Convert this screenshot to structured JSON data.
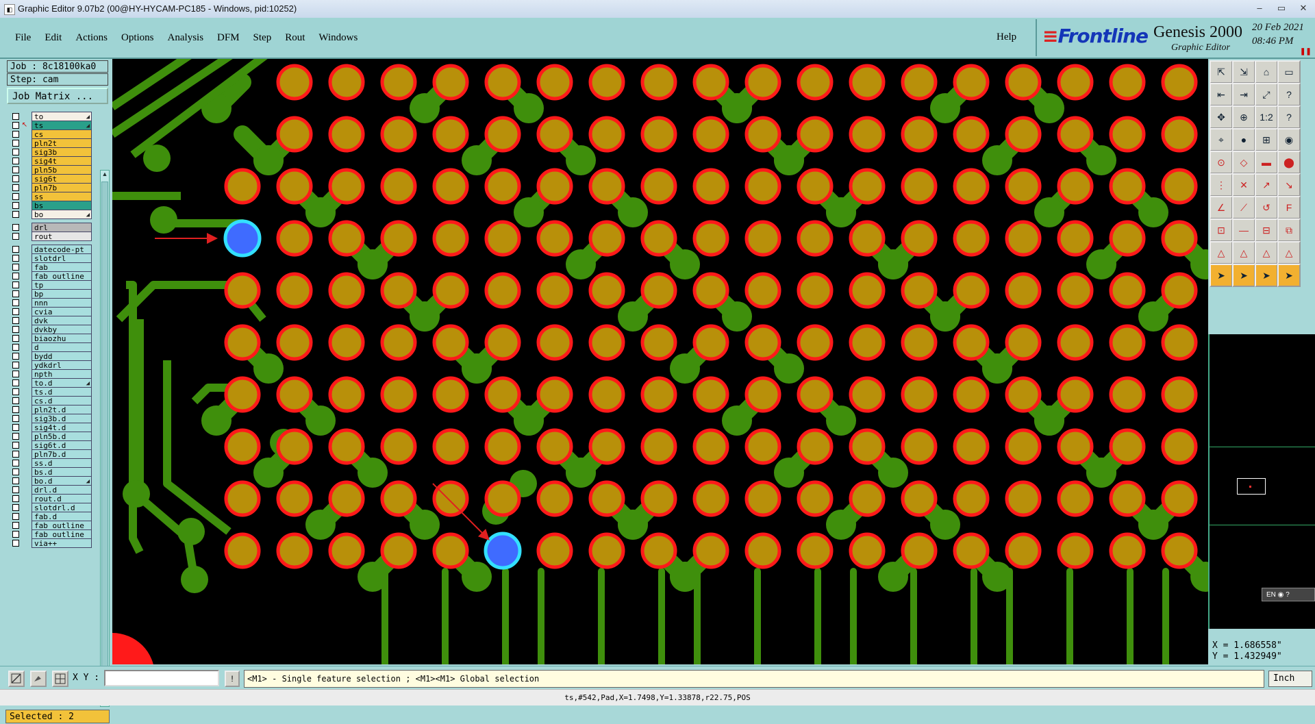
{
  "window": {
    "title": "Graphic Editor 9.07b2 (00@HY-HYCAM-PC185 - Windows, pid:10252)",
    "min": "–",
    "max": "▭",
    "close": "✕"
  },
  "menu": [
    "File",
    "Edit",
    "Actions",
    "Options",
    "Analysis",
    "DFM",
    "Step",
    "Rout",
    "Windows"
  ],
  "help_label": "Help",
  "brand": {
    "logo": "Frontline",
    "product": "Genesis 2000",
    "subtitle": "Graphic Editor",
    "date": "20 Feb 2021",
    "time": "08:46 PM"
  },
  "job": "Job : 8c18100ka0",
  "step": "Step: cam",
  "job_matrix": "Job Matrix ...",
  "layers": [
    {
      "name": "to",
      "color": "#f5f0e6",
      "marker": "",
      "editable": true
    },
    {
      "name": "ts",
      "color": "#2aa08a",
      "marker": "↖",
      "editable": true
    },
    {
      "name": "cs",
      "color": "#f2c23a",
      "marker": "",
      "editable": false
    },
    {
      "name": "pln2t",
      "color": "#f2c23a",
      "marker": "",
      "editable": false
    },
    {
      "name": "sig3b",
      "color": "#f2c23a",
      "marker": "",
      "editable": false
    },
    {
      "name": "sig4t",
      "color": "#f2c23a",
      "marker": "",
      "editable": false
    },
    {
      "name": "pln5b",
      "color": "#f2c23a",
      "marker": "",
      "editable": false
    },
    {
      "name": "sig6t",
      "color": "#f2c23a",
      "marker": "",
      "editable": false
    },
    {
      "name": "pln7b",
      "color": "#f2c23a",
      "marker": "",
      "editable": false
    },
    {
      "name": "ss",
      "color": "#f2c23a",
      "marker": "",
      "editable": false
    },
    {
      "name": "bs",
      "color": "#2aa08a",
      "marker": "",
      "editable": false
    },
    {
      "name": "bo",
      "color": "#f5f0e6",
      "marker": "",
      "editable": true
    },
    {
      "name": "drl",
      "color": "#b8b8b8",
      "marker": "",
      "editable": false
    },
    {
      "name": "rout",
      "color": "#e6e6e6",
      "marker": "",
      "editable": false
    },
    {
      "name": "datecode-pt",
      "color": "#a8dede",
      "marker": "",
      "editable": false
    },
    {
      "name": "slotdrl",
      "color": "#a8dede",
      "marker": "",
      "editable": false
    },
    {
      "name": "fab",
      "color": "#a8dede",
      "marker": "",
      "editable": false
    },
    {
      "name": "fab_outline",
      "color": "#a8dede",
      "marker": "",
      "editable": false
    },
    {
      "name": "tp",
      "color": "#a8dede",
      "marker": "",
      "editable": false
    },
    {
      "name": "bp",
      "color": "#a8dede",
      "marker": "",
      "editable": false
    },
    {
      "name": "nnn",
      "color": "#a8dede",
      "marker": "",
      "editable": false
    },
    {
      "name": "cvia",
      "color": "#a8dede",
      "marker": "",
      "editable": false
    },
    {
      "name": "dvk",
      "color": "#a8dede",
      "marker": "",
      "editable": false
    },
    {
      "name": "dvkby",
      "color": "#a8dede",
      "marker": "",
      "editable": false
    },
    {
      "name": "biaozhu",
      "color": "#a8dede",
      "marker": "",
      "editable": false
    },
    {
      "name": "d",
      "color": "#a8dede",
      "marker": "",
      "editable": false
    },
    {
      "name": "bydd",
      "color": "#a8dede",
      "marker": "",
      "editable": false
    },
    {
      "name": "ydkdrl",
      "color": "#a8dede",
      "marker": "",
      "editable": false
    },
    {
      "name": "npth",
      "color": "#a8dede",
      "marker": "",
      "editable": false
    },
    {
      "name": "to.d",
      "color": "#a8dede",
      "marker": "",
      "editable": true
    },
    {
      "name": "ts.d",
      "color": "#a8dede",
      "marker": "",
      "editable": false
    },
    {
      "name": "cs.d",
      "color": "#a8dede",
      "marker": "",
      "editable": false
    },
    {
      "name": "pln2t.d",
      "color": "#a8dede",
      "marker": "",
      "editable": false
    },
    {
      "name": "sig3b.d",
      "color": "#a8dede",
      "marker": "",
      "editable": false
    },
    {
      "name": "sig4t.d",
      "color": "#a8dede",
      "marker": "",
      "editable": false
    },
    {
      "name": "pln5b.d",
      "color": "#a8dede",
      "marker": "",
      "editable": false
    },
    {
      "name": "sig6t.d",
      "color": "#a8dede",
      "marker": "",
      "editable": false
    },
    {
      "name": "pln7b.d",
      "color": "#a8dede",
      "marker": "",
      "editable": false
    },
    {
      "name": "ss.d",
      "color": "#a8dede",
      "marker": "",
      "editable": false
    },
    {
      "name": "bs.d",
      "color": "#a8dede",
      "marker": "",
      "editable": false
    },
    {
      "name": "bo.d",
      "color": "#a8dede",
      "marker": "",
      "editable": true
    },
    {
      "name": "drl.d",
      "color": "#a8dede",
      "marker": "",
      "editable": false
    },
    {
      "name": "rout.d",
      "color": "#a8dede",
      "marker": "",
      "editable": false
    },
    {
      "name": "slotdrl.d",
      "color": "#a8dede",
      "marker": "",
      "editable": false
    },
    {
      "name": "fab.d",
      "color": "#a8dede",
      "marker": "",
      "editable": false
    },
    {
      "name": "fab_outline",
      "color": "#a8dede",
      "marker": "",
      "editable": false
    },
    {
      "name": "fab_outline",
      "color": "#a8dede",
      "marker": "",
      "editable": false
    },
    {
      "name": "via++",
      "color": "#a8dede",
      "marker": "",
      "editable": false
    }
  ],
  "selected": "Selected : 2",
  "colors": {
    "trace": "#3f8f0c",
    "pad_fill": "#b8900a",
    "pad_ring": "#ff1a1a",
    "selected_pad": "#3f6bff",
    "selected_ring": "#33e0ff",
    "canvas_bg": "#000000",
    "arrow": "#e02020"
  },
  "tools": [
    "layer-up-icon",
    "layer-down-icon",
    "home-icon",
    "window-icon",
    "zoom-prev-icon",
    "zoom-next-icon",
    "zoom-fit-icon",
    "help-icon",
    "pan-icon",
    "zoom-in-icon",
    "scale-icon",
    "query-icon",
    "snap-icon",
    "measure-icon",
    "grid-icon",
    "drill-icon",
    "add-pad-icon",
    "add-line-icon",
    "ruler-icon",
    "circle-icon",
    "select-multi-icon",
    "cross-icon",
    "route-icon",
    "line-icon",
    "draw-line-icon",
    "slant-icon",
    "arc-icon",
    "font-icon",
    "add-feature-icon",
    "horizontal-icon",
    "box-icon",
    "copy-icon",
    "triangle-icon",
    "triangle-2-icon",
    "triangle-3-icon",
    "triangle-4-icon",
    "pointer-icon",
    "pointer-2-icon",
    "pointer-3-icon",
    "pointer-4-icon"
  ],
  "ime": "EN",
  "coords": {
    "x": "X = 1.686558\"",
    "y": "Y = 1.432949\""
  },
  "xy_label": "X Y :",
  "xy_input": "",
  "hint": "<M1> - Single feature selection ; <M1><M1> Global selection",
  "unit": "Inch",
  "status": "ts,#542,Pad,X=1.7498,Y=1.33878,r22.75,POS"
}
